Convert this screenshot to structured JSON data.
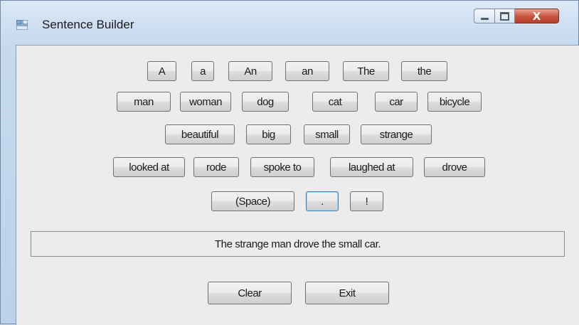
{
  "window": {
    "title": "Sentence Builder"
  },
  "controls": {
    "close_glyph": "X"
  },
  "rows": [
    [
      "A",
      "a",
      "An",
      "an",
      "The",
      "the"
    ],
    [
      "man",
      "woman",
      "dog",
      "cat",
      "car",
      "bicycle"
    ],
    [
      "beautiful",
      "big",
      "small",
      "strange"
    ],
    [
      "looked at",
      "rode",
      "spoke to",
      "laughed at",
      "drove"
    ],
    [
      "(Space)",
      ".",
      "!"
    ]
  ],
  "output": {
    "sentence": "The strange man drove the small car."
  },
  "actions": {
    "clear_label": "Clear",
    "exit_label": "Exit"
  }
}
